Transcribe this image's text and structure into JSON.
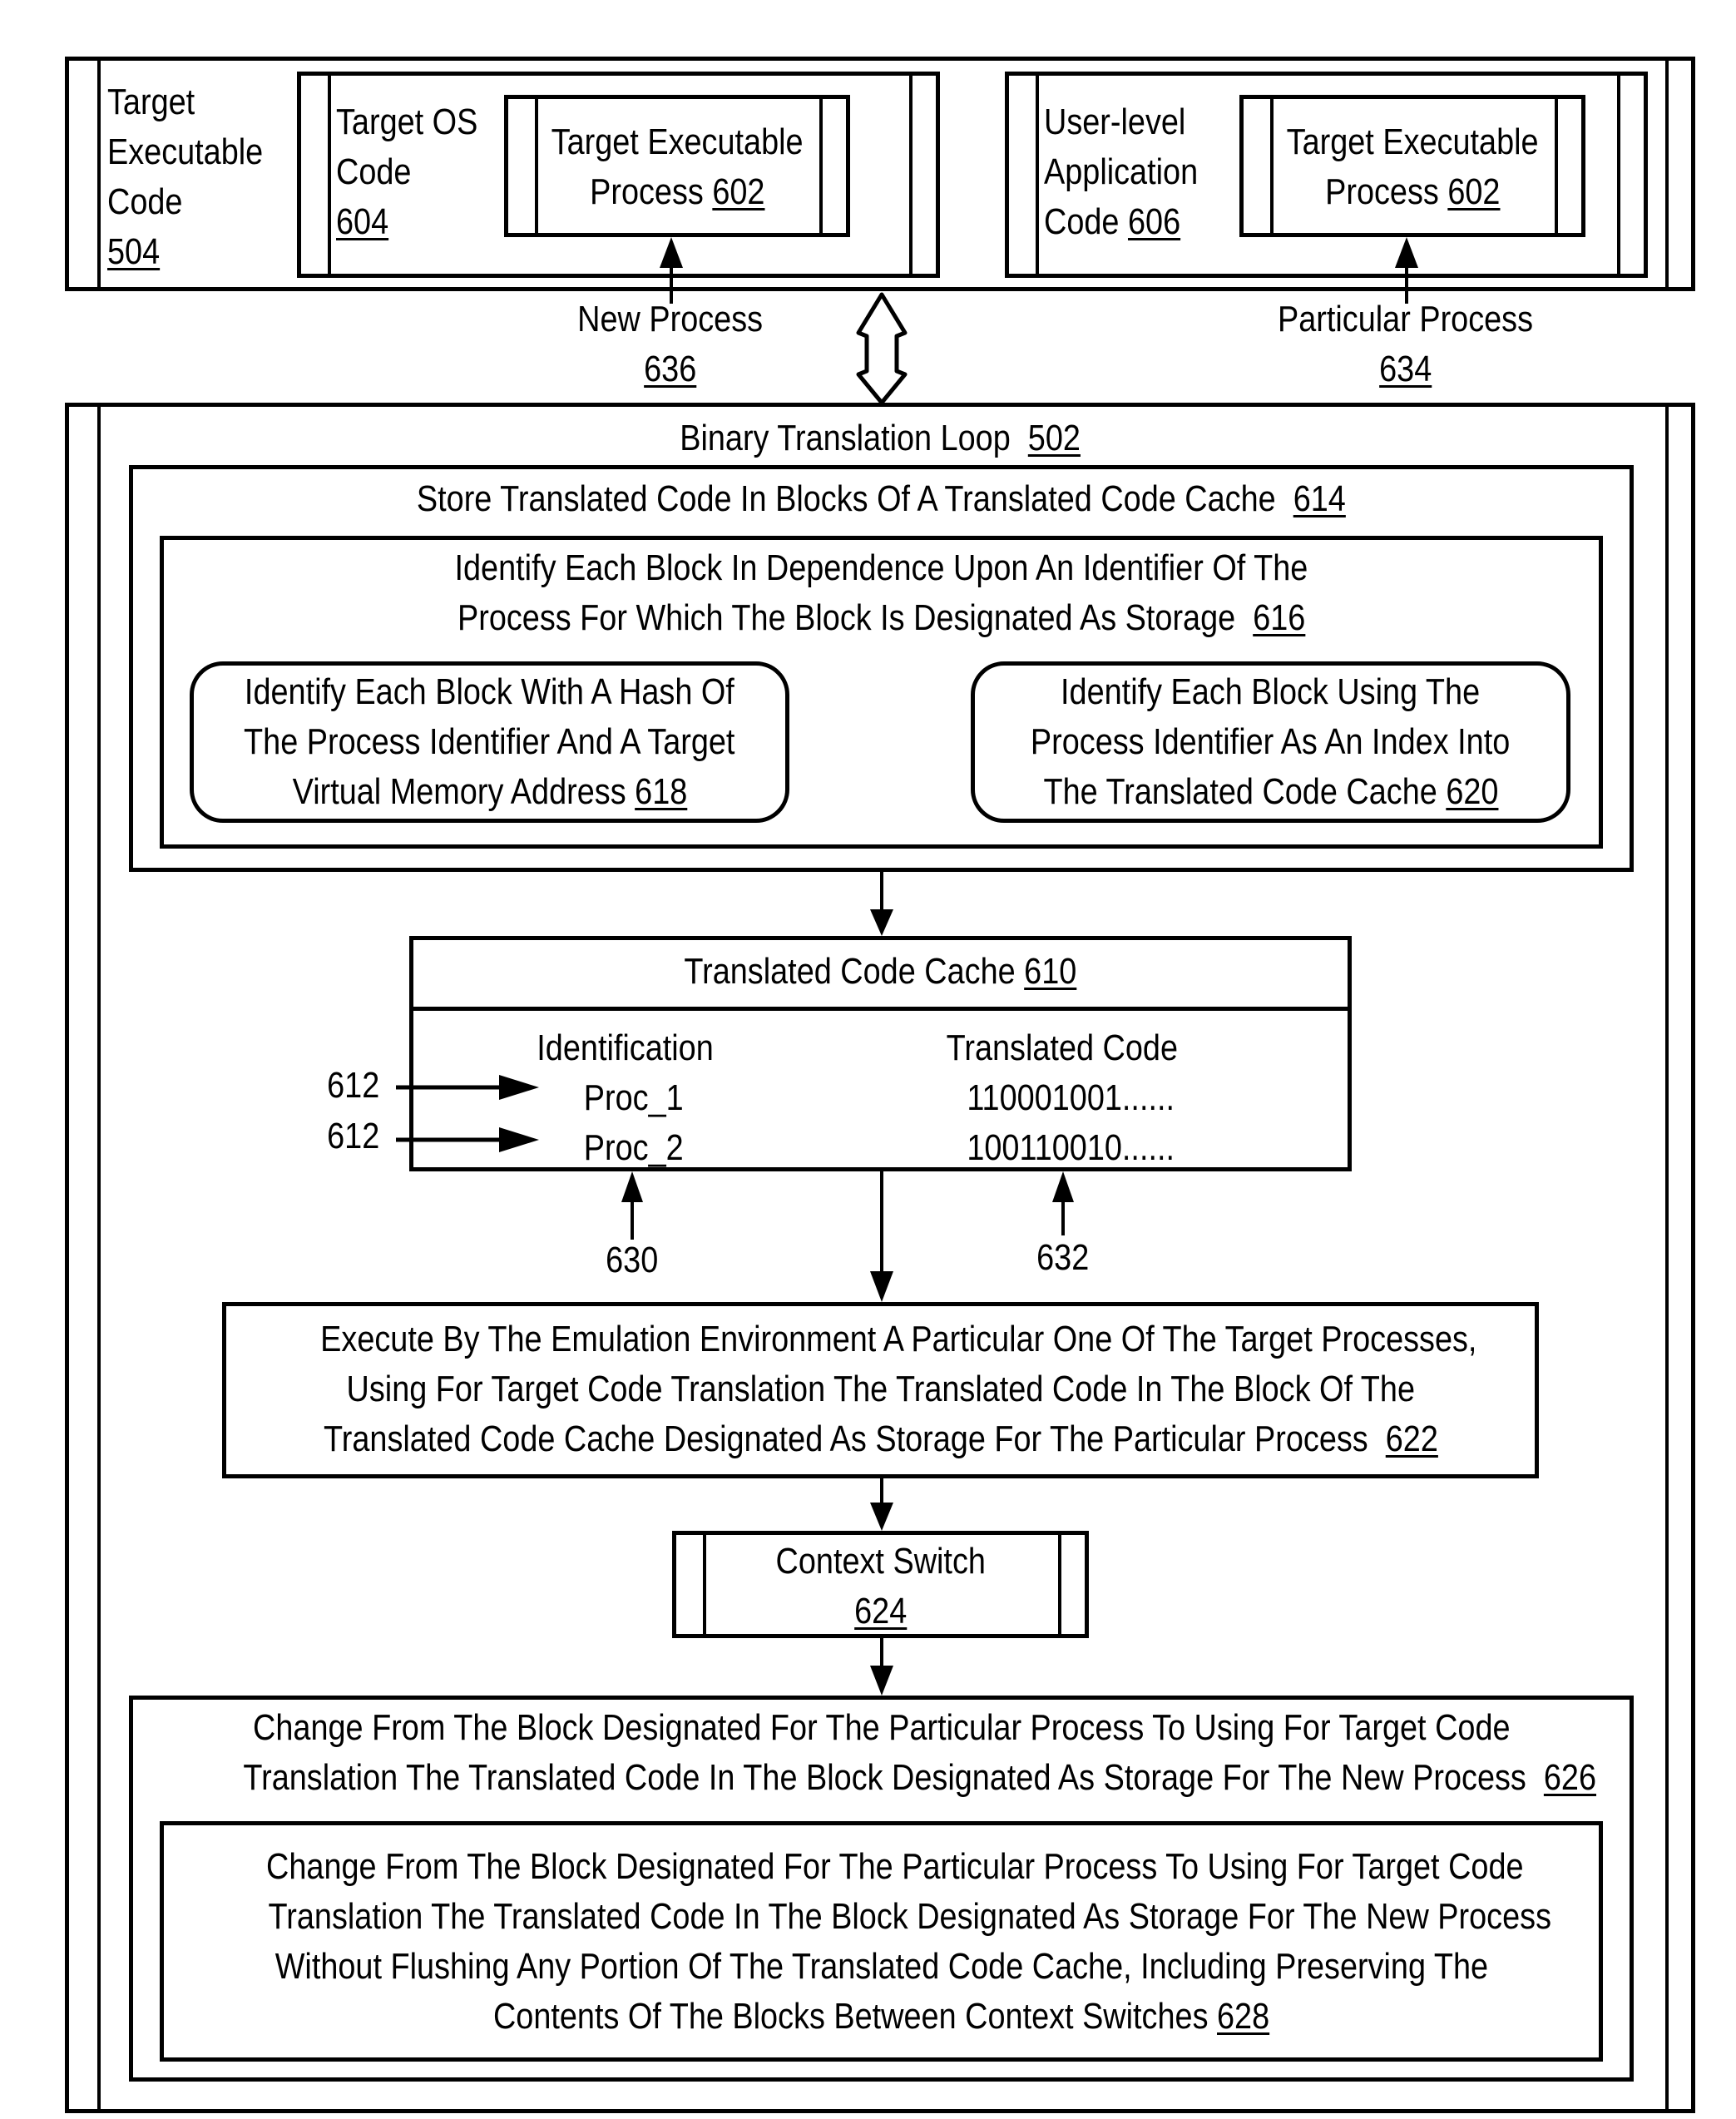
{
  "top": {
    "outer": {
      "label_lines": [
        "Target",
        "Executable",
        "Code"
      ],
      "ref": "504"
    },
    "os_code": {
      "label_lines": [
        "Target OS",
        "Code"
      ],
      "ref": "604",
      "process": {
        "label_lines": [
          "Target Executable",
          "Process"
        ],
        "ref": "602"
      }
    },
    "app_code": {
      "label_lines": [
        "User-level",
        "Application",
        "Code"
      ],
      "ref": "606",
      "process": {
        "label_lines": [
          "Target Executable",
          "Process"
        ],
        "ref": "602"
      }
    },
    "new_process": {
      "label": "New Process",
      "ref": "636"
    },
    "particular_process": {
      "label": "Particular Process",
      "ref": "634"
    }
  },
  "loop": {
    "title": "Binary Translation Loop",
    "ref": "502",
    "store": {
      "label": "Store Translated Code In Blocks Of A Translated Code Cache",
      "ref": "614",
      "identify": {
        "lines": [
          "Identify Each Block In Dependence Upon An Identifier Of The",
          "Process For Which The Block Is Designated As Storage"
        ],
        "ref": "616",
        "hash": {
          "lines": [
            "Identify Each Block With A Hash Of",
            "The Process Identifier And A Target",
            "Virtual Memory Address"
          ],
          "ref": "618"
        },
        "index": {
          "lines": [
            "Identify Each Block Using The",
            "Process Identifier As An Index Into",
            "The Translated Code Cache"
          ],
          "ref": "620"
        }
      }
    },
    "cache": {
      "title": "Translated Code Cache",
      "ref": "610",
      "columns": [
        "Identification",
        "Translated Code"
      ],
      "rows": [
        {
          "id": "Proc_1",
          "code": "110001001......",
          "pointer_ref": "612"
        },
        {
          "id": "Proc_2",
          "code": "100110010......",
          "pointer_ref": "612"
        }
      ],
      "id_ref": "630",
      "code_ref": "632"
    },
    "execute": {
      "lines": [
        "Execute By The Emulation Environment A Particular One Of The Target Processes,",
        "Using For Target Code Translation The Translated Code In The Block Of The",
        "Translated Code Cache Designated As Storage For The Particular Process"
      ],
      "ref": "622"
    },
    "context_switch": {
      "label": "Context Switch",
      "ref": "624"
    },
    "change": {
      "lines": [
        "Change From The Block Designated For The Particular Process To Using For Target Code",
        "Translation The Translated Code In The Block Designated As Storage For The New Process"
      ],
      "ref": "626",
      "inner": {
        "lines": [
          "Change From The Block Designated For The Particular Process To Using For Target Code",
          "Translation The Translated Code In The Block Designated As Storage For The New Process",
          "Without Flushing Any Portion Of The Translated Code Cache, Including Preserving The",
          "Contents Of The Blocks Between Context Switches"
        ],
        "ref": "628"
      }
    }
  }
}
